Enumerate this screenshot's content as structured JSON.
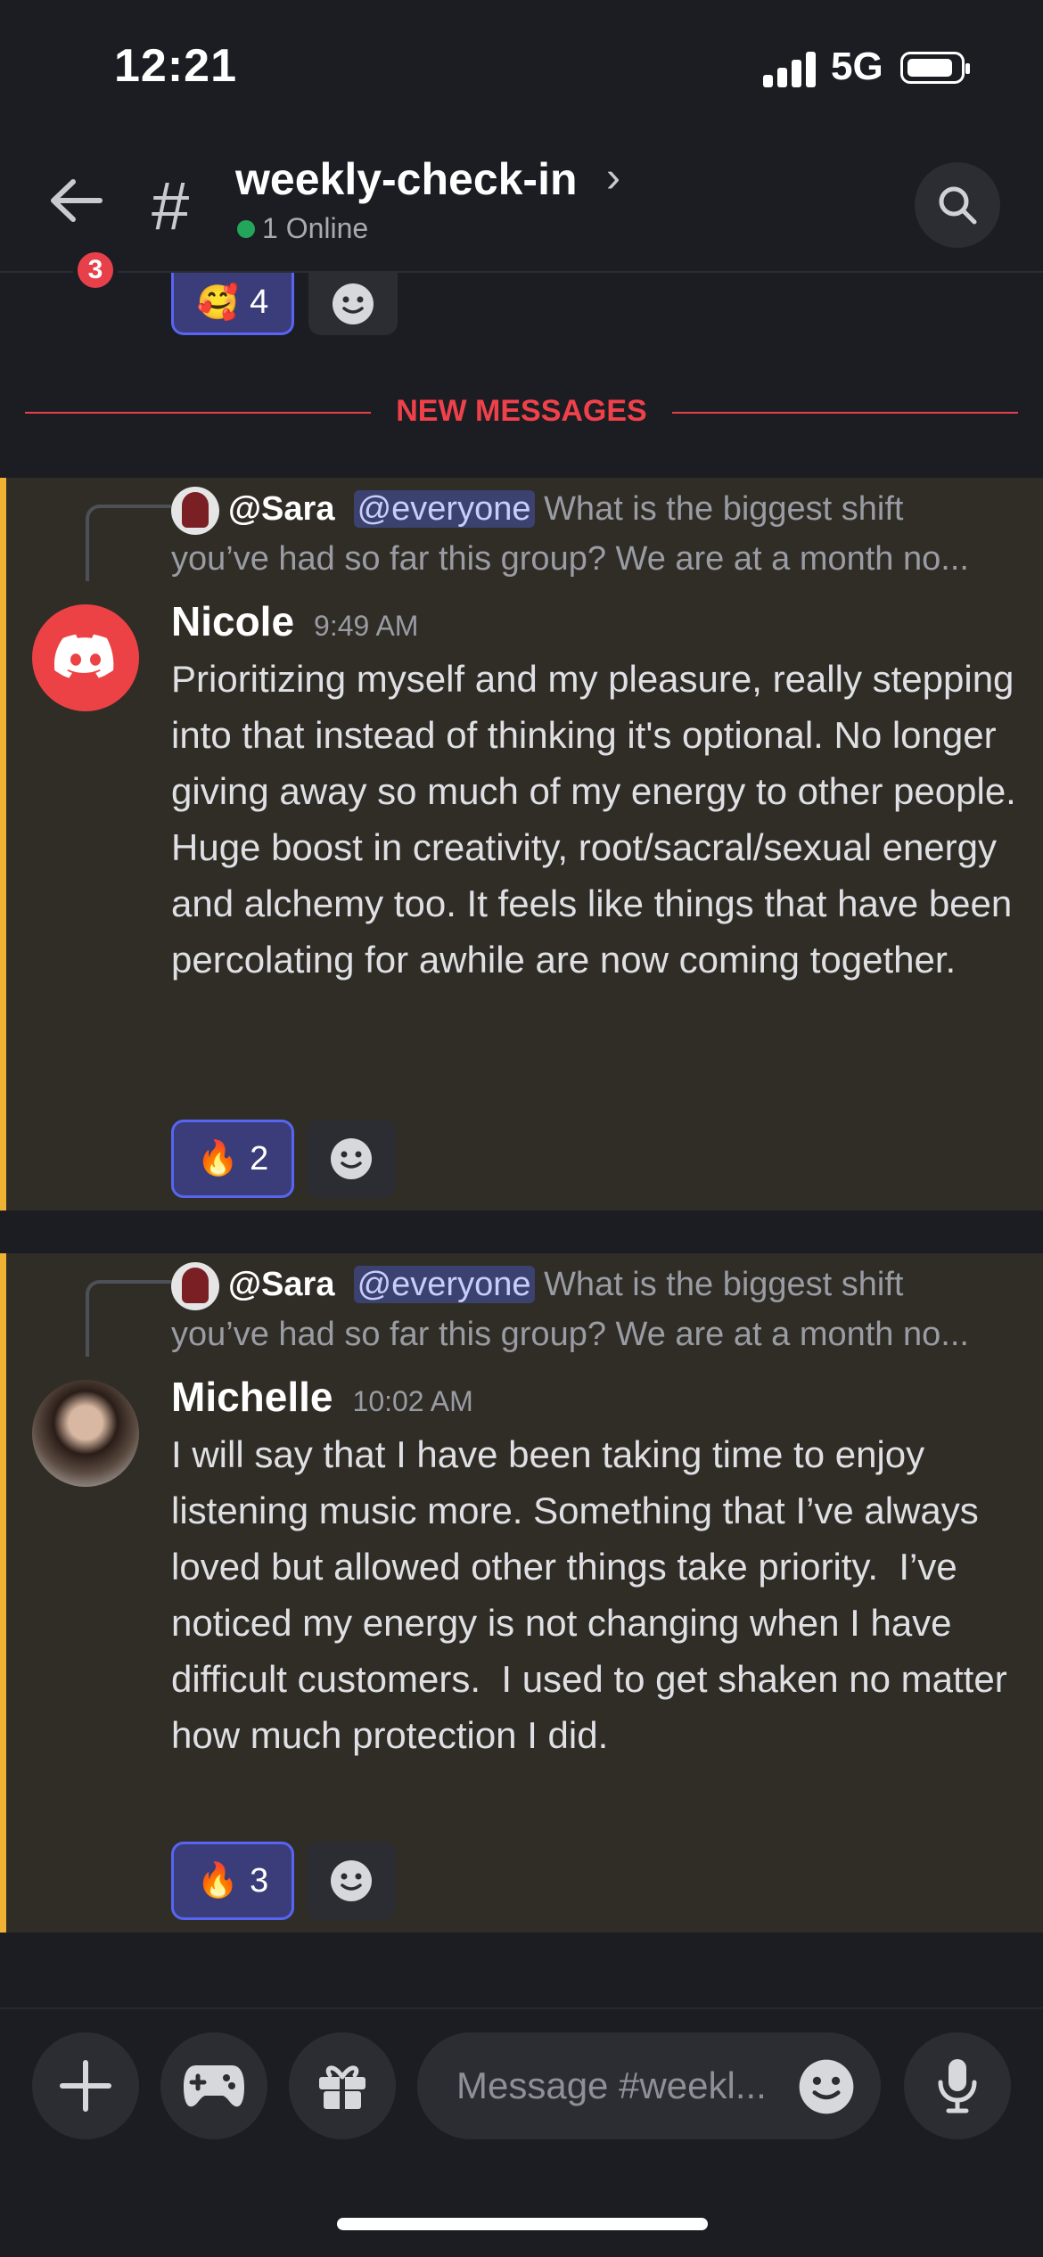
{
  "status_bar": {
    "time": "12:21",
    "network": "5G"
  },
  "header": {
    "back_badge": "3",
    "hash": "#",
    "channel_name": "weekly-check-in",
    "chevron": "›",
    "online": "1 Online"
  },
  "top_reactions": {
    "emoji": "🥰",
    "count": "4"
  },
  "divider": {
    "label": "NEW MESSAGES"
  },
  "messages": [
    {
      "reply_user": "@Sara",
      "reply_mention": "@everyone",
      "reply_text": "What is the biggest shift you’ve had so far this group? We are at a month no...",
      "author": "Nicole",
      "time": "9:49 AM",
      "text": "Prioritizing myself and my pleasure, really stepping into that instead of thinking it's optional. No longer giving away so much of my energy to other people. Huge boost in creativity, root/sacral/sexual energy and alchemy too. It feels like things that have been percolating for awhile are now coming together.",
      "reaction_emoji": "🔥",
      "reaction_count": "2"
    },
    {
      "reply_user": "@Sara",
      "reply_mention": "@everyone",
      "reply_text": "What is the biggest shift you’ve had so far this group? We are at a month no...",
      "author": "Michelle",
      "time": "10:02 AM",
      "text": "I will say that I have been taking time to enjoy listening music more. Something that I’ve always loved but allowed other things take priority.  I’ve noticed my energy is not changing when I have difficult customers.  I used to get shaken no matter how much protection I did.",
      "reaction_emoji": "🔥",
      "reaction_count": "3"
    }
  ],
  "composer": {
    "placeholder": "Message #weekl..."
  },
  "colors": {
    "background": "#1c1d22",
    "highlight_block": "#302d27",
    "accent_bar": "#f0b232",
    "new_messages_red": "#f0414b",
    "reaction_active": "#5865f2",
    "online_green": "#23a55a"
  }
}
